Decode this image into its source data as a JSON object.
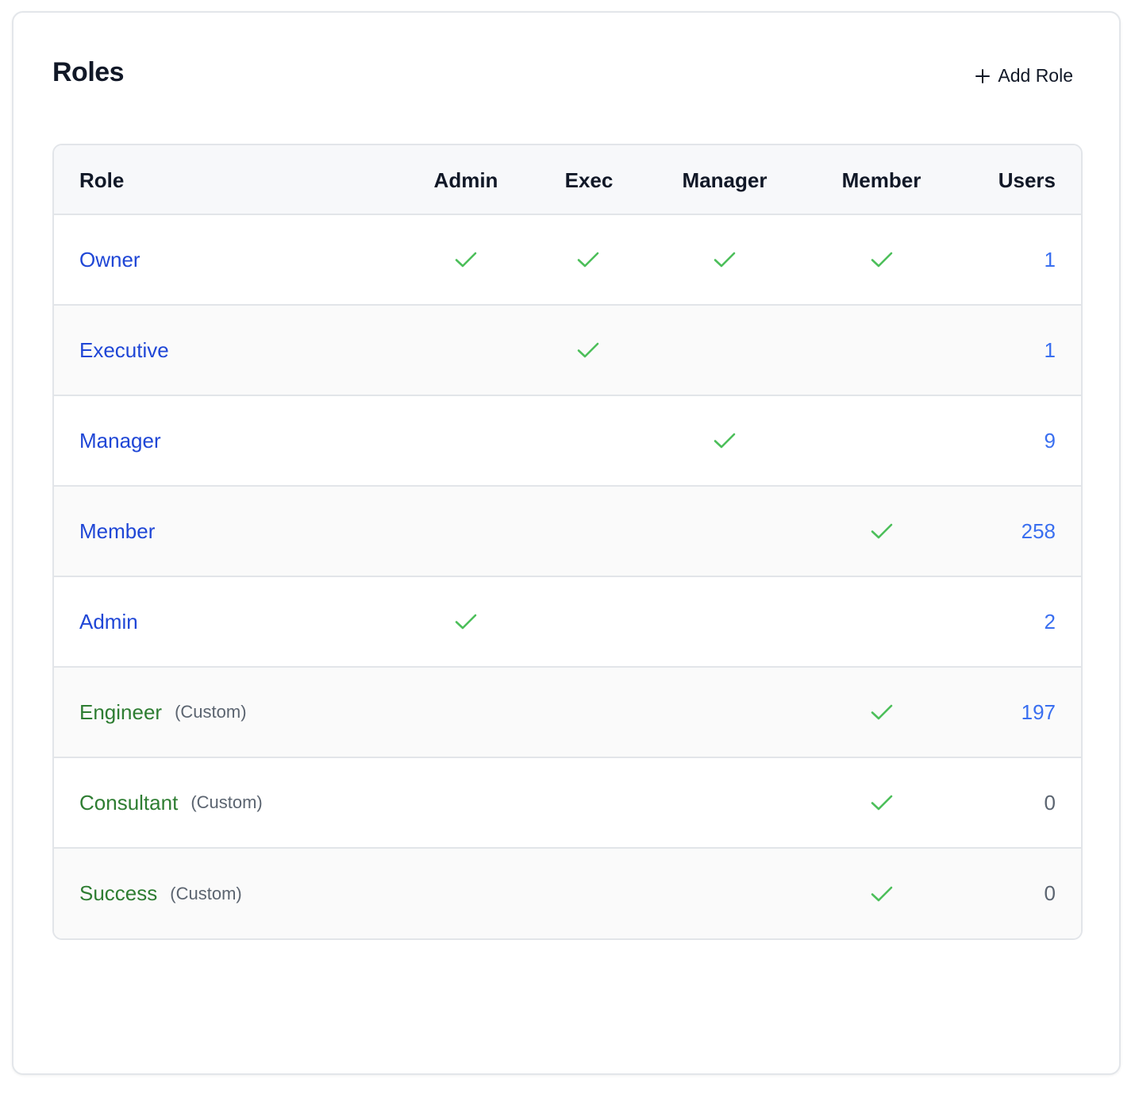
{
  "header": {
    "title": "Roles",
    "add_button_label": "Add Role"
  },
  "table": {
    "columns": [
      "Role",
      "Admin",
      "Exec",
      "Manager",
      "Member",
      "Users"
    ],
    "rows": [
      {
        "role": "Owner",
        "custom_tag": "",
        "admin": true,
        "exec": true,
        "manager": true,
        "member": true,
        "users": "1"
      },
      {
        "role": "Executive",
        "custom_tag": "",
        "admin": false,
        "exec": true,
        "manager": false,
        "member": false,
        "users": "1"
      },
      {
        "role": "Manager",
        "custom_tag": "",
        "admin": false,
        "exec": false,
        "manager": true,
        "member": false,
        "users": "9"
      },
      {
        "role": "Member",
        "custom_tag": "",
        "admin": false,
        "exec": false,
        "manager": false,
        "member": true,
        "users": "258"
      },
      {
        "role": "Admin",
        "custom_tag": "",
        "admin": true,
        "exec": false,
        "manager": false,
        "member": false,
        "users": "2"
      },
      {
        "role": "Engineer",
        "custom_tag": "(Custom)",
        "admin": false,
        "exec": false,
        "manager": false,
        "member": true,
        "users": "197"
      },
      {
        "role": "Consultant",
        "custom_tag": "(Custom)",
        "admin": false,
        "exec": false,
        "manager": false,
        "member": true,
        "users": "0"
      },
      {
        "role": "Success",
        "custom_tag": "(Custom)",
        "admin": false,
        "exec": false,
        "manager": false,
        "member": true,
        "users": "0"
      }
    ]
  },
  "colors": {
    "standard_role": "#1f46d6",
    "custom_role": "#2e7d32",
    "check": "#4cbf5a",
    "user_count_link": "#3a6ff0",
    "user_count_zero": "#5b6470"
  },
  "icons": {
    "add": "plus-icon",
    "permission": "check-icon"
  }
}
